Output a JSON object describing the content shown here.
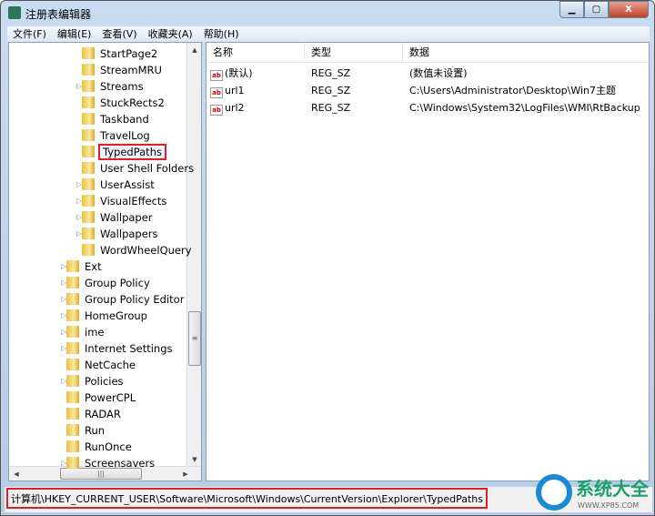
{
  "window": {
    "title": "注册表编辑器",
    "controls": [
      "minimize",
      "maximize",
      "close"
    ]
  },
  "menu": [
    "文件(F)",
    "编辑(E)",
    "查看(V)",
    "收藏夹(A)",
    "帮助(H)"
  ],
  "tree": {
    "items": [
      {
        "label": "StartPage2",
        "level": 2,
        "expandable": false
      },
      {
        "label": "StreamMRU",
        "level": 2,
        "expandable": false
      },
      {
        "label": "Streams",
        "level": 2,
        "expandable": true
      },
      {
        "label": "StuckRects2",
        "level": 2,
        "expandable": false
      },
      {
        "label": "Taskband",
        "level": 2,
        "expandable": false
      },
      {
        "label": "TravelLog",
        "level": 2,
        "expandable": false
      },
      {
        "label": "TypedPaths",
        "level": 2,
        "expandable": false,
        "selected": true
      },
      {
        "label": "User Shell Folders",
        "level": 2,
        "expandable": false
      },
      {
        "label": "UserAssist",
        "level": 2,
        "expandable": true
      },
      {
        "label": "VisualEffects",
        "level": 2,
        "expandable": true
      },
      {
        "label": "Wallpaper",
        "level": 2,
        "expandable": true
      },
      {
        "label": "Wallpapers",
        "level": 2,
        "expandable": true
      },
      {
        "label": "WordWheelQuery",
        "level": 2,
        "expandable": false
      },
      {
        "label": "Ext",
        "level": 1,
        "expandable": true
      },
      {
        "label": "Group Policy",
        "level": 1,
        "expandable": true
      },
      {
        "label": "Group Policy Editor",
        "level": 1,
        "expandable": true
      },
      {
        "label": "HomeGroup",
        "level": 1,
        "expandable": true
      },
      {
        "label": "ime",
        "level": 1,
        "expandable": true
      },
      {
        "label": "Internet Settings",
        "level": 1,
        "expandable": true
      },
      {
        "label": "NetCache",
        "level": 1,
        "expandable": false
      },
      {
        "label": "Policies",
        "level": 1,
        "expandable": true
      },
      {
        "label": "PowerCPL",
        "level": 1,
        "expandable": false
      },
      {
        "label": "RADAR",
        "level": 1,
        "expandable": false
      },
      {
        "label": "Run",
        "level": 1,
        "expandable": false
      },
      {
        "label": "RunOnce",
        "level": 1,
        "expandable": false
      },
      {
        "label": "Screensavers",
        "level": 1,
        "expandable": true
      }
    ]
  },
  "list": {
    "columns": [
      "名称",
      "类型",
      "数据"
    ],
    "rows": [
      {
        "name": "(默认)",
        "type": "REG_SZ",
        "data": "(数值未设置)"
      },
      {
        "name": "url1",
        "type": "REG_SZ",
        "data": "C:\\Users\\Administrator\\Desktop\\Win7主题"
      },
      {
        "name": "url2",
        "type": "REG_SZ",
        "data": "C:\\Windows\\System32\\LogFiles\\WMI\\RtBackup"
      }
    ]
  },
  "status": {
    "path": "计算机\\HKEY_CURRENT_USER\\Software\\Microsoft\\Windows\\CurrentVersion\\Explorer\\TypedPaths"
  },
  "watermark": {
    "text": "系统大全",
    "url": "WWW.XP85.COM"
  },
  "colors": {
    "highlight": "#e02020",
    "logo_blue": "#1a8ad4",
    "logo_green": "#1ea06a"
  }
}
